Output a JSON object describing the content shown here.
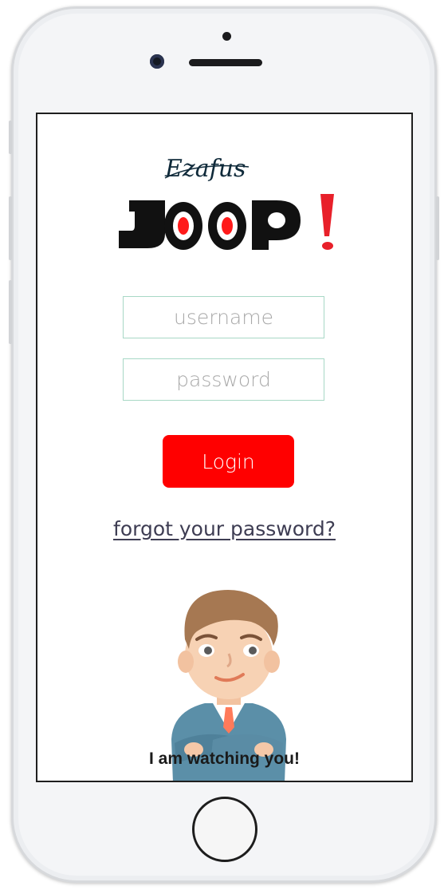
{
  "app": {
    "brand_script": "Ezafus",
    "brand_name": "JOOP!",
    "accent_color": "#ff0000"
  },
  "login_form": {
    "username_placeholder": "username",
    "password_placeholder": "password",
    "login_label": "Login",
    "forgot_label": "forgot your password?"
  },
  "mascot": {
    "caption": "I am watching you!"
  }
}
